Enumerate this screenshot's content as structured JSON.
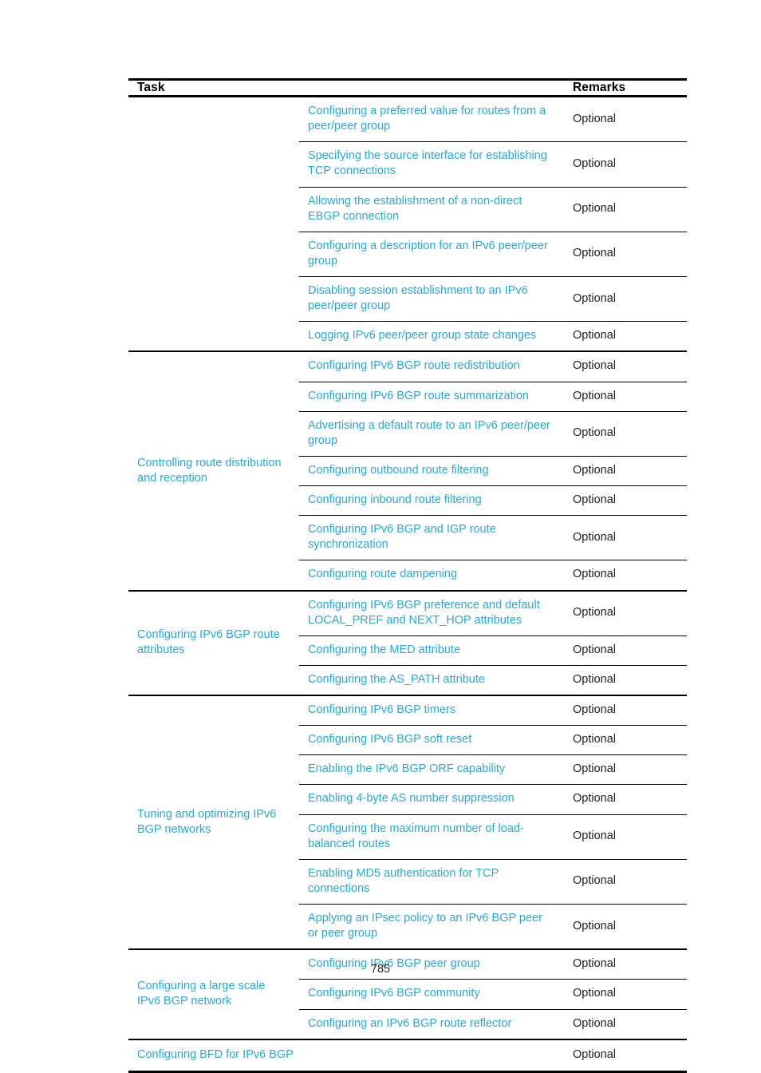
{
  "page": {
    "number": "785",
    "link_color": "#27a8e0",
    "text_color": "#231f20",
    "rule_color": "#000000"
  },
  "table": {
    "headers": {
      "group": "",
      "task": "Task",
      "remarks": "Remarks"
    },
    "sections": [
      {
        "label": "",
        "rows": [
          {
            "task": "Configuring a preferred value for routes from a peer/peer group",
            "remark": "Optional"
          },
          {
            "task": "Specifying the source interface for establishing TCP connections",
            "remark": "Optional"
          },
          {
            "task": "Allowing the establishment of a non-direct EBGP connection",
            "remark": "Optional"
          },
          {
            "task": "Configuring a description for an IPv6 peer/peer group",
            "remark": "Optional"
          },
          {
            "task": "Disabling session establishment to an IPv6 peer/peer group",
            "remark": "Optional"
          },
          {
            "task": "Logging IPv6 peer/peer group state changes",
            "remark": "Optional"
          }
        ]
      },
      {
        "label": "Controlling route distribution and reception",
        "rows": [
          {
            "task": "Configuring IPv6 BGP route redistribution",
            "remark": "Optional"
          },
          {
            "task": "Configuring IPv6 BGP route summarization",
            "remark": "Optional"
          },
          {
            "task": "Advertising a default route to an IPv6 peer/peer group",
            "remark": "Optional"
          },
          {
            "task": "Configuring outbound route filtering",
            "remark": "Optional"
          },
          {
            "task": "Configuring inbound route filtering",
            "remark": "Optional"
          },
          {
            "task": "Configuring IPv6 BGP and IGP route synchronization",
            "remark": "Optional"
          },
          {
            "task": "Configuring route dampening",
            "remark": "Optional"
          }
        ]
      },
      {
        "label": "Configuring IPv6 BGP route attributes",
        "rows": [
          {
            "task": "Configuring IPv6 BGP preference and default LOCAL_PREF and NEXT_HOP attributes",
            "remark": "Optional"
          },
          {
            "task": "Configuring the MED attribute",
            "remark": "Optional"
          },
          {
            "task": "Configuring the AS_PATH attribute",
            "remark": "Optional"
          }
        ]
      },
      {
        "label": "Tuning and optimizing IPv6 BGP networks",
        "rows": [
          {
            "task": "Configuring IPv6 BGP timers",
            "remark": "Optional"
          },
          {
            "task": "Configuring IPv6 BGP soft reset",
            "remark": "Optional"
          },
          {
            "task": "Enabling the IPv6 BGP ORF capability",
            "remark": "Optional"
          },
          {
            "task": "Enabling 4-byte AS number suppression",
            "remark": "Optional"
          },
          {
            "task": "Configuring the maximum number of load-balanced routes",
            "remark": "Optional"
          },
          {
            "task": "Enabling MD5 authentication for TCP connections",
            "remark": "Optional"
          },
          {
            "task": "Applying an IPsec policy to an IPv6 BGP peer or peer group",
            "remark": "Optional"
          }
        ]
      },
      {
        "label": "Configuring a large scale IPv6 BGP network",
        "rows": [
          {
            "task": "Configuring IPv6 BGP peer group",
            "remark": "Optional"
          },
          {
            "task": "Configuring IPv6 BGP community",
            "remark": "Optional"
          },
          {
            "task": "Configuring an IPv6 BGP route reflector",
            "remark": "Optional"
          }
        ]
      }
    ],
    "final_row": {
      "task": "Configuring BFD for IPv6 BGP",
      "remark": "Optional"
    }
  }
}
